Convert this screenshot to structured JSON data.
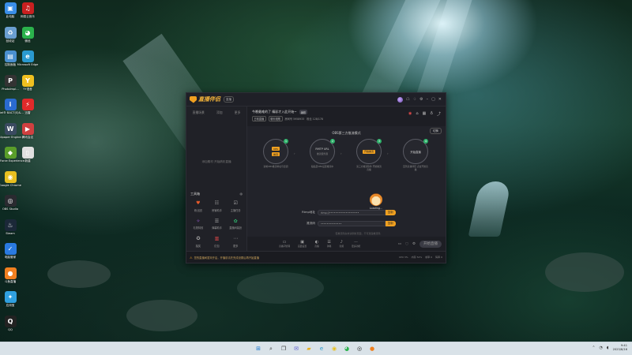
{
  "desktop": {
    "icons": [
      {
        "label": "此电脑",
        "icon": "computer-icon",
        "color": "#3a8ee8"
      },
      {
        "label": "回收站",
        "icon": "recycle-bin-icon",
        "color": "#6a9fd0"
      },
      {
        "label": "控制面板",
        "icon": "control-panel-icon",
        "color": "#4a90d0"
      },
      {
        "label": "PhotoImpl...",
        "icon": "photoimpact-icon",
        "color": "#333333"
      },
      {
        "label": "Intel® BACT(S)&...",
        "icon": "intel-icon",
        "color": "#2a6bd0"
      },
      {
        "label": "Wallpaper Engine:...",
        "icon": "wallpaper-engine-icon",
        "color": "#3a4a60"
      },
      {
        "label": "GeForce Experience",
        "icon": "geforce-icon",
        "color": "#5a9e2a"
      },
      {
        "label": "Google Chrome",
        "icon": "chrome-icon",
        "color": "#e8c020"
      },
      {
        "label": "OBS Studio",
        "icon": "obs-icon",
        "color": "#2a2a30"
      },
      {
        "label": "Steam",
        "icon": "steam-icon",
        "color": "#1b2838"
      },
      {
        "label": "电脑管家",
        "icon": "pc-manager-icon",
        "color": "#2a7ae0"
      },
      {
        "label": "斗鱼直播",
        "icon": "douyu-icon",
        "color": "#f08020"
      },
      {
        "label": "应用宝",
        "icon": "app-store-icon",
        "color": "#30a0e0"
      },
      {
        "label": "QQ",
        "icon": "qq-icon",
        "color": "#222222"
      },
      {
        "label": "网易云音乐",
        "icon": "netease-music-icon",
        "color": "#c82020"
      },
      {
        "label": "微信",
        "icon": "wechat-icon",
        "color": "#2bb24c"
      },
      {
        "label": "Microsoft Edge",
        "icon": "edge-icon",
        "color": "#2a9ad0"
      },
      {
        "label": "YY语音",
        "icon": "yy-icon",
        "color": "#f0c020"
      },
      {
        "label": "迅雷",
        "icon": "xunlei-icon",
        "color": "#e02a2a"
      },
      {
        "label": "腾讯会议",
        "icon": "tencent-meeting-icon",
        "color": "#d04040"
      },
      {
        "label": "新建",
        "icon": "file-icon",
        "color": "#e0e0e0"
      }
    ]
  },
  "app": {
    "brand": "直播伴侣",
    "badge": "直播",
    "window_controls": [
      "avatar",
      "gift-icon",
      "shirt-icon",
      "settings-icon",
      "minimize-icon",
      "maximize-icon",
      "close-icon"
    ],
    "left": {
      "tabs": [
        "直播场景",
        "添加",
        "更多"
      ],
      "empty_hint": "添加素材 开始精彩直播",
      "tools_title": "工具箱",
      "tools": [
        {
          "label": "粉丝团",
          "icon": "fans-icon",
          "color": "#e85a2a"
        },
        {
          "label": "房管助手",
          "icon": "manager-icon",
          "color": "#aaaaaa"
        },
        {
          "label": "主播任务",
          "icon": "task-icon",
          "color": "#aaaaaa"
        },
        {
          "label": "礼物特效",
          "icon": "gift-fx-icon",
          "color": "#9a5ad0"
        },
        {
          "label": "弹幕助手",
          "icon": "danmu-icon",
          "color": "#aaaaaa"
        },
        {
          "label": "直播间装扮",
          "icon": "decor-icon",
          "color": "#2fb26b"
        },
        {
          "label": "抽奖",
          "icon": "lottery-icon",
          "color": "#aaaaaa"
        },
        {
          "label": "红包",
          "icon": "redpacket-icon",
          "color": "#e84b4b"
        },
        {
          "label": "更多",
          "icon": "more-icon",
          "color": "#aaaaaa"
        }
      ]
    },
    "room": {
      "title": "今晚最难的了 精彩才入此开始~",
      "edit_label": "编辑",
      "tags": [
        "日常直播",
        "聊天唱歌"
      ],
      "meta": [
        "房间号 5958933",
        "粉丝 128/178"
      ]
    },
    "stage": {
      "title": "OBS第三方推流模式",
      "switch_label": "切换",
      "steps": [
        {
          "num": "1",
          "chips": [
            "OBS",
            "推流"
          ],
          "title": "",
          "sub": "",
          "caption": "复制OBS推流地址与密钥"
        },
        {
          "num": "2",
          "chips": [],
          "title": "RMTP URL",
          "sub": "推流服务器",
          "caption": "粘贴至OBS设置推流中"
        },
        {
          "num": "3",
          "chips": [
            "开始推流"
          ],
          "title": "",
          "sub": "",
          "caption": "第三方推流软件 开始推流直播"
        },
        {
          "num": "4",
          "chips": [],
          "title": "开始直播",
          "sub": "",
          "caption": "回到直播伴侣 点击开始直播"
        }
      ],
      "loading_text": "Loading...",
      "rtmp_label": "Rtmp地址",
      "rtmp_value": "rtmp://••••••••••••••••••••",
      "key_label": "推流码",
      "key_value": "••••••••••••••",
      "copy_label": "复制",
      "tip": "若推流码失效请刷新页面，不可泄露推流码"
    },
    "bottom_items": [
      {
        "label": "直播间管理",
        "icon": "room-icon"
      },
      {
        "label": "画面设置",
        "icon": "screen-icon"
      },
      {
        "label": "直播",
        "icon": "live-icon"
      },
      {
        "label": "弹幕",
        "icon": "danmu-bar-icon"
      },
      {
        "label": "音频",
        "icon": "audio-icon"
      },
      {
        "label": "更多功能",
        "icon": "more-func-icon"
      }
    ],
    "start_label": "开始直播",
    "status": {
      "message": "您的直播间暂未开启，开播前请先完成设置后再开始直播",
      "stats": [
        "CPU 3%",
        "内存 52%",
        "帧率 0",
        "码率 0"
      ]
    }
  },
  "taskbar": {
    "time": "9:41",
    "date": "2023/8/16",
    "icons": [
      {
        "icon": "windows-start-icon",
        "color": "#1a78d0"
      },
      {
        "icon": "search-icon",
        "color": "#333333"
      },
      {
        "icon": "task-view-icon",
        "color": "#333333"
      },
      {
        "icon": "chat-icon",
        "color": "#5a5ad0"
      },
      {
        "icon": "file-explorer-icon",
        "color": "#e8b020"
      },
      {
        "icon": "edge-icon",
        "color": "#2a9ad0"
      },
      {
        "icon": "chrome-icon",
        "color": "#e8c020"
      },
      {
        "icon": "wechat-icon",
        "color": "#2bb24c"
      },
      {
        "icon": "obs-icon",
        "color": "#222222"
      },
      {
        "icon": "douyu-icon",
        "color": "#f08020"
      }
    ]
  }
}
